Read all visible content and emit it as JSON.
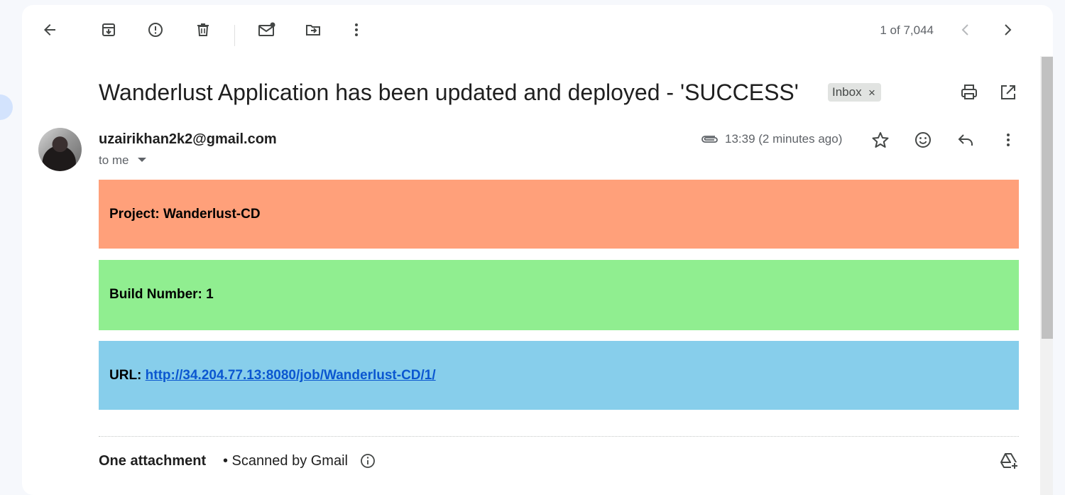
{
  "toolbar": {
    "counter": "1 of 7,044"
  },
  "email": {
    "subject": "Wanderlust Application has been updated and deployed - 'SUCCESS'",
    "label": "Inbox",
    "label_remove": "×",
    "sender": "uzairikhan2k2@gmail.com",
    "recipient": "to me",
    "time": "13:39 (2 minutes ago)"
  },
  "body": {
    "project_text": "Project: Wanderlust-CD",
    "build_text": "Build Number: 1",
    "url_label": "URL:",
    "url_link": "http://34.204.77.13:8080/job/Wanderlust-CD/1/"
  },
  "attachments": {
    "title": "One attachment",
    "scanned": "• Scanned by Gmail"
  },
  "colors": {
    "project_bg": "#ffa07a",
    "build_bg": "#90ee90",
    "url_bg": "#87ceeb",
    "link": "#0b57d0"
  },
  "icons": [
    "back-arrow-icon",
    "archive-icon",
    "report-spam-icon",
    "delete-icon",
    "mark-unread-icon",
    "move-to-icon",
    "more-vert-icon",
    "chevron-left-icon",
    "chevron-right-icon",
    "print-icon",
    "open-new-window-icon",
    "attachment-clip-icon",
    "star-icon",
    "emoji-icon",
    "reply-icon",
    "info-icon",
    "add-to-drive-icon"
  ]
}
